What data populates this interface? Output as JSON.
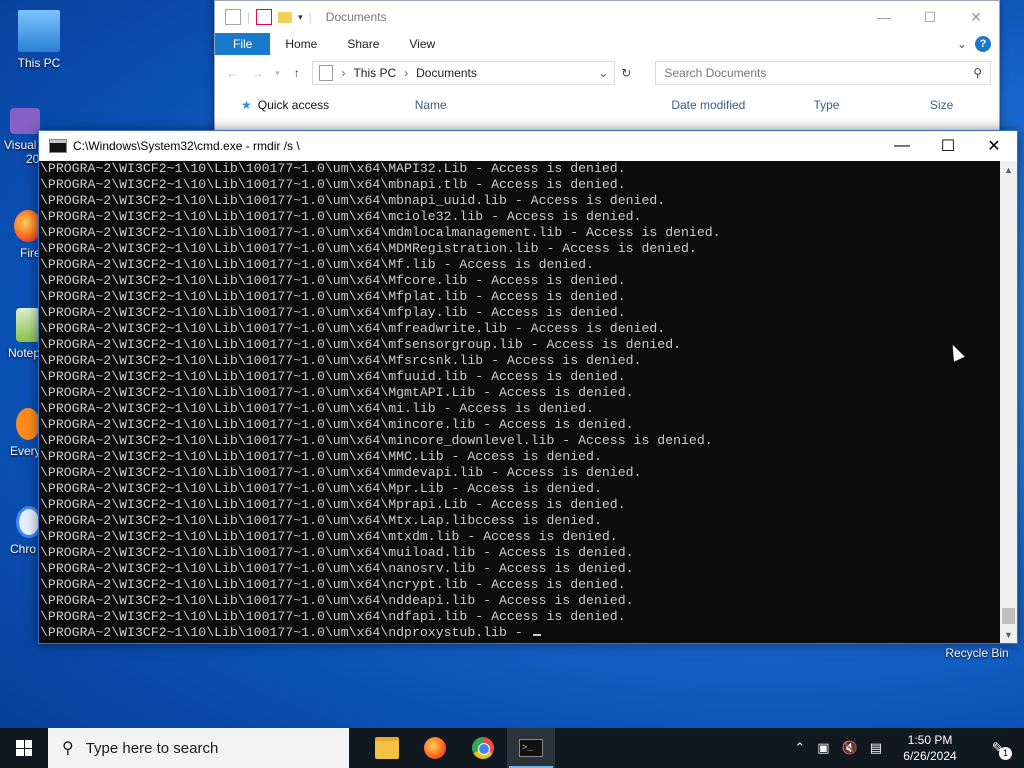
{
  "desktop": {
    "icons": [
      {
        "label": "This PC"
      },
      {
        "label": "Visual"
      },
      {
        "label": "20"
      },
      {
        "label": "Fire"
      },
      {
        "label": "Notep"
      },
      {
        "label": "Every"
      },
      {
        "label": "Chro"
      }
    ],
    "recycle_bin": "Recycle Bin"
  },
  "explorer": {
    "title": "Documents",
    "ribbon_tabs": [
      "File",
      "Home",
      "Share",
      "View"
    ],
    "help": "?",
    "address": {
      "root": "This PC",
      "folder": "Documents"
    },
    "search_placeholder": "Search Documents",
    "nav_pane_item": "Quick access",
    "columns": [
      "Name",
      "Date modified",
      "Type",
      "Size"
    ]
  },
  "cmd": {
    "title": "C:\\Windows\\System32\\cmd.exe - rmdir  /s \\",
    "lines": [
      "\\PROGRA~2\\WI3CF2~1\\10\\Lib\\100177~1.0\\um\\x64\\MAPI32.Lib - Access is denied.",
      "\\PROGRA~2\\WI3CF2~1\\10\\Lib\\100177~1.0\\um\\x64\\mbnapi.tlb - Access is denied.",
      "\\PROGRA~2\\WI3CF2~1\\10\\Lib\\100177~1.0\\um\\x64\\mbnapi_uuid.lib - Access is denied.",
      "\\PROGRA~2\\WI3CF2~1\\10\\Lib\\100177~1.0\\um\\x64\\mciole32.lib - Access is denied.",
      "\\PROGRA~2\\WI3CF2~1\\10\\Lib\\100177~1.0\\um\\x64\\mdmlocalmanagement.lib - Access is denied.",
      "\\PROGRA~2\\WI3CF2~1\\10\\Lib\\100177~1.0\\um\\x64\\MDMRegistration.lib - Access is denied.",
      "\\PROGRA~2\\WI3CF2~1\\10\\Lib\\100177~1.0\\um\\x64\\Mf.lib - Access is denied.",
      "\\PROGRA~2\\WI3CF2~1\\10\\Lib\\100177~1.0\\um\\x64\\Mfcore.lib - Access is denied.",
      "\\PROGRA~2\\WI3CF2~1\\10\\Lib\\100177~1.0\\um\\x64\\Mfplat.lib - Access is denied.",
      "\\PROGRA~2\\WI3CF2~1\\10\\Lib\\100177~1.0\\um\\x64\\mfplay.lib - Access is denied.",
      "\\PROGRA~2\\WI3CF2~1\\10\\Lib\\100177~1.0\\um\\x64\\mfreadwrite.lib - Access is denied.",
      "\\PROGRA~2\\WI3CF2~1\\10\\Lib\\100177~1.0\\um\\x64\\mfsensorgroup.lib - Access is denied.",
      "\\PROGRA~2\\WI3CF2~1\\10\\Lib\\100177~1.0\\um\\x64\\Mfsrcsnk.lib - Access is denied.",
      "\\PROGRA~2\\WI3CF2~1\\10\\Lib\\100177~1.0\\um\\x64\\mfuuid.lib - Access is denied.",
      "\\PROGRA~2\\WI3CF2~1\\10\\Lib\\100177~1.0\\um\\x64\\MgmtAPI.Lib - Access is denied.",
      "\\PROGRA~2\\WI3CF2~1\\10\\Lib\\100177~1.0\\um\\x64\\mi.lib - Access is denied.",
      "\\PROGRA~2\\WI3CF2~1\\10\\Lib\\100177~1.0\\um\\x64\\mincore.lib - Access is denied.",
      "\\PROGRA~2\\WI3CF2~1\\10\\Lib\\100177~1.0\\um\\x64\\mincore_downlevel.lib - Access is denied.",
      "\\PROGRA~2\\WI3CF2~1\\10\\Lib\\100177~1.0\\um\\x64\\MMC.Lib - Access is denied.",
      "\\PROGRA~2\\WI3CF2~1\\10\\Lib\\100177~1.0\\um\\x64\\mmdevapi.lib - Access is denied.",
      "\\PROGRA~2\\WI3CF2~1\\10\\Lib\\100177~1.0\\um\\x64\\Mpr.Lib - Access is denied.",
      "\\PROGRA~2\\WI3CF2~1\\10\\Lib\\100177~1.0\\um\\x64\\Mprapi.Lib - Access is denied.",
      "\\PROGRA~2\\WI3CF2~1\\10\\Lib\\100177~1.0\\um\\x64\\Mtx.Lap.libccess is denied.",
      "\\PROGRA~2\\WI3CF2~1\\10\\Lib\\100177~1.0\\um\\x64\\mtxdm.lib - Access is denied.",
      "\\PROGRA~2\\WI3CF2~1\\10\\Lib\\100177~1.0\\um\\x64\\muiload.lib - Access is denied.",
      "\\PROGRA~2\\WI3CF2~1\\10\\Lib\\100177~1.0\\um\\x64\\nanosrv.lib - Access is denied.",
      "\\PROGRA~2\\WI3CF2~1\\10\\Lib\\100177~1.0\\um\\x64\\ncrypt.lib - Access is denied.",
      "\\PROGRA~2\\WI3CF2~1\\10\\Lib\\100177~1.0\\um\\x64\\nddeapi.lib - Access is denied.",
      "\\PROGRA~2\\WI3CF2~1\\10\\Lib\\100177~1.0\\um\\x64\\ndfapi.lib - Access is denied.",
      "\\PROGRA~2\\WI3CF2~1\\10\\Lib\\100177~1.0\\um\\x64\\ndproxystub.lib - "
    ]
  },
  "taskbar": {
    "search_placeholder": "Type here to search",
    "apps": [
      "file-explorer",
      "firefox",
      "chrome",
      "command-prompt"
    ],
    "time": "1:50 PM",
    "date": "6/26/2024",
    "notification_count": "1"
  },
  "colors": {
    "accent": "#1979ca",
    "console_bg": "#0c0c0c",
    "console_fg": "#cccccc",
    "taskbar_bg": "#101820"
  }
}
